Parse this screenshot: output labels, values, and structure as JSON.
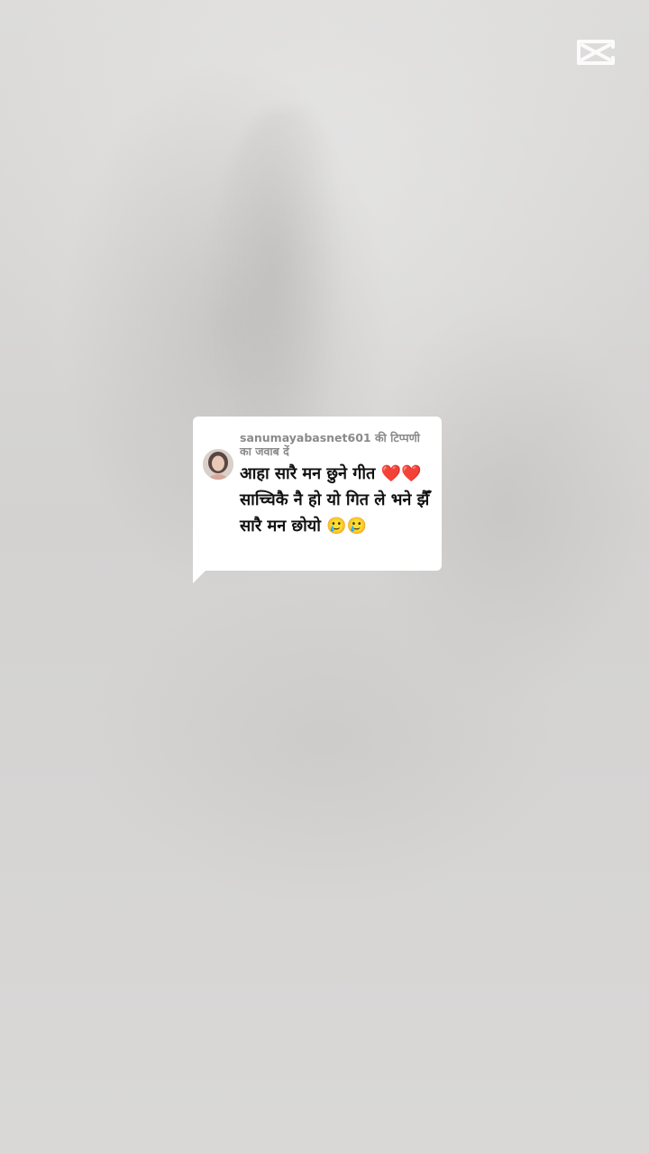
{
  "watermark": {
    "icon": "capcut-logo-icon"
  },
  "reply_card": {
    "header": "sanumayabasnet601 की टिप्पणी का जवाब दें",
    "avatar_icon": "user-avatar",
    "comment": "आहा सारै मन छुने गीत ❤️❤️ साच्चिकै नै हो यो गित ले भने झैँ सारै मन छोयो 🥲🥲"
  },
  "colors": {
    "background": "#d7d6d5",
    "card": "#ffffff",
    "header_text": "#8a8a8a",
    "comment_text": "#111111"
  }
}
